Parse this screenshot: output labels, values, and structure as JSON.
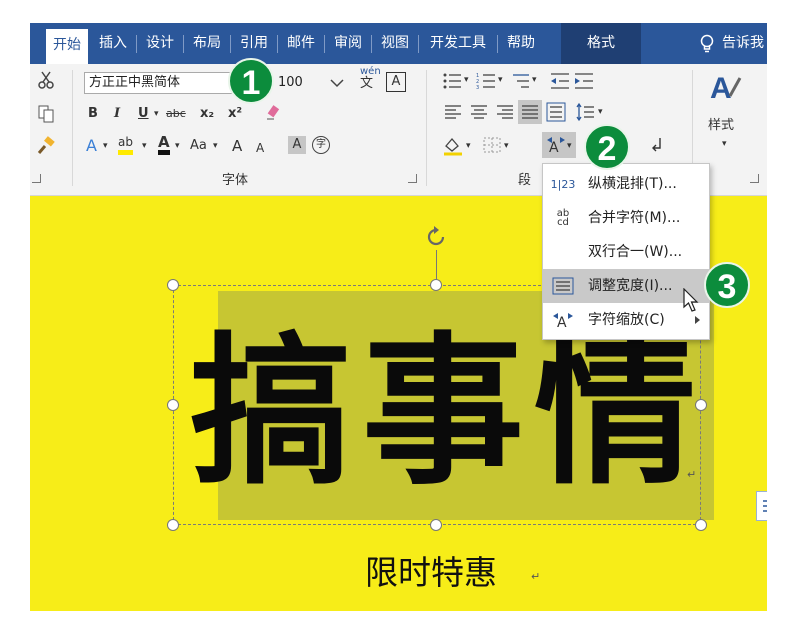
{
  "tabs": [
    {
      "label": "开始",
      "active": true
    },
    {
      "label": "插入"
    },
    {
      "label": "设计"
    },
    {
      "label": "布局"
    },
    {
      "label": "引用"
    },
    {
      "label": "邮件"
    },
    {
      "label": "审阅"
    },
    {
      "label": "视图"
    },
    {
      "label": "开发工具"
    },
    {
      "label": "帮助"
    },
    {
      "label": "格式"
    },
    {
      "label": "告诉我"
    }
  ],
  "ribbon": {
    "font_name": "方正正中黑简体",
    "font_size": "100",
    "font_group_label": "字体",
    "para_group_label": "段",
    "styles_label": "样式",
    "bold": "B",
    "italic": "I",
    "underline": "U",
    "strike": "abc",
    "subscript": "x₂",
    "superscript": "x²",
    "change_case": "Aa",
    "grow_font": "A",
    "shrink_font": "A",
    "char_shading": "A",
    "enclose_char": "字",
    "phonetic": "wén",
    "phonetic_sub": "文",
    "border_char": "A",
    "font_color_label": "A",
    "text_effect": "A"
  },
  "menu": {
    "items": [
      {
        "label": "纵横混排(T)...",
        "icon": "vertical-horizontal-icon",
        "icon_text": "1|23"
      },
      {
        "label": "合并字符(M)...",
        "icon": "combine-chars-icon",
        "icon_text": "ab cd"
      },
      {
        "label": "双行合一(W)...",
        "icon": "",
        "icon_text": ""
      },
      {
        "label": "调整宽度(I)...",
        "icon": "adjust-width-icon",
        "icon_text": "",
        "hover": true
      },
      {
        "label": "字符缩放(C)",
        "icon": "char-scale-icon",
        "icon_text": "",
        "submenu": true
      }
    ]
  },
  "document": {
    "headline": "搞事情",
    "subtitle": "限时特惠",
    "para_mark": "↵"
  },
  "badges": [
    "1",
    "2",
    "3"
  ],
  "colors": {
    "tab_bar": "#2b579a",
    "doc_background": "#f7ed18",
    "textbox_fill": "#c7c632",
    "badge": "#0c8c3c"
  }
}
